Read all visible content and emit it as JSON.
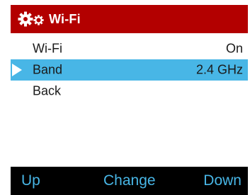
{
  "colors": {
    "title_bar": "#b30000",
    "selection": "#48b6e6",
    "softkey_bar": "#000000",
    "softkey_text": "#48b6e6"
  },
  "header": {
    "icon": "gears-icon",
    "title": "Wi-Fi"
  },
  "menu": {
    "items": [
      {
        "label": "Wi-Fi",
        "value": "On",
        "selected": false
      },
      {
        "label": "Band",
        "value": "2.4 GHz",
        "selected": true
      },
      {
        "label": "Back",
        "value": "",
        "selected": false
      }
    ]
  },
  "softkeys": {
    "left": "Up",
    "center": "Change",
    "right": "Down"
  }
}
